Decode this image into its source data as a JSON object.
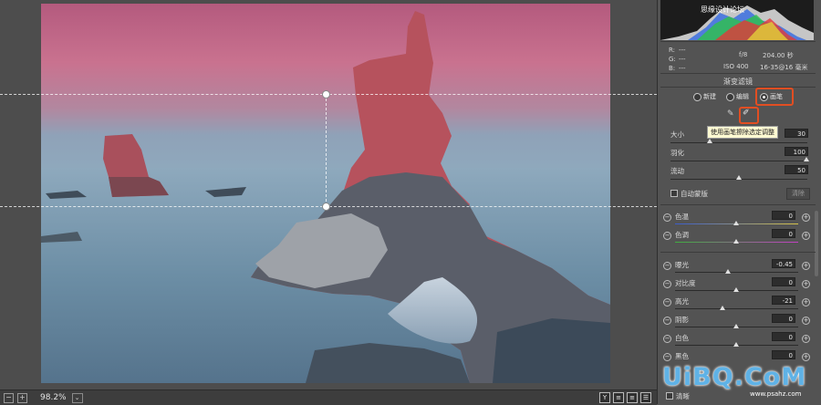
{
  "statusbar": {
    "zoom": "98.2%",
    "minus": "−",
    "plus": "+",
    "drop": "⌄",
    "right_icons": [
      "Y",
      "≡",
      "≡",
      "☰"
    ]
  },
  "histogram_info": {
    "r": "R:",
    "g": "G:",
    "b": "B:",
    "r_val": "---",
    "g_val": "---",
    "b_val": "---",
    "aperture": "f/8",
    "shutter": "204.00 秒",
    "iso": "ISO 400",
    "lens": "16-35@16 毫米"
  },
  "panel": {
    "title": "渐变滤镜",
    "modes": [
      {
        "label": "新建"
      },
      {
        "label": "编辑"
      },
      {
        "label": "画笔"
      }
    ],
    "tooltip": "使用画笔擦除选定调整",
    "brush": {
      "size": {
        "label": "大小",
        "value": "30"
      },
      "feather": {
        "label": "羽化",
        "value": "100"
      },
      "flow": {
        "label": "流动",
        "value": "50"
      },
      "auto_mask": "自动蒙版",
      "clear": "清除"
    },
    "adjust": [
      {
        "label": "色温",
        "value": "0"
      },
      {
        "label": "色调",
        "value": "0"
      },
      {
        "label": "曝光",
        "value": "-0.45"
      },
      {
        "label": "对比度",
        "value": "0"
      },
      {
        "label": "高光",
        "value": "-21"
      },
      {
        "label": "阴影",
        "value": "0"
      },
      {
        "label": "白色",
        "value": "0"
      },
      {
        "label": "黑色",
        "value": "0"
      }
    ],
    "bottom_label": "清晰"
  },
  "watermark": {
    "main": "UiBQ.CoM",
    "sub": "www.psahz.com",
    "top": "思缘设计论坛"
  },
  "colors": {
    "accent": "#e24e22",
    "panel_bg": "#535353",
    "sky_mask": "#c56f8e"
  }
}
